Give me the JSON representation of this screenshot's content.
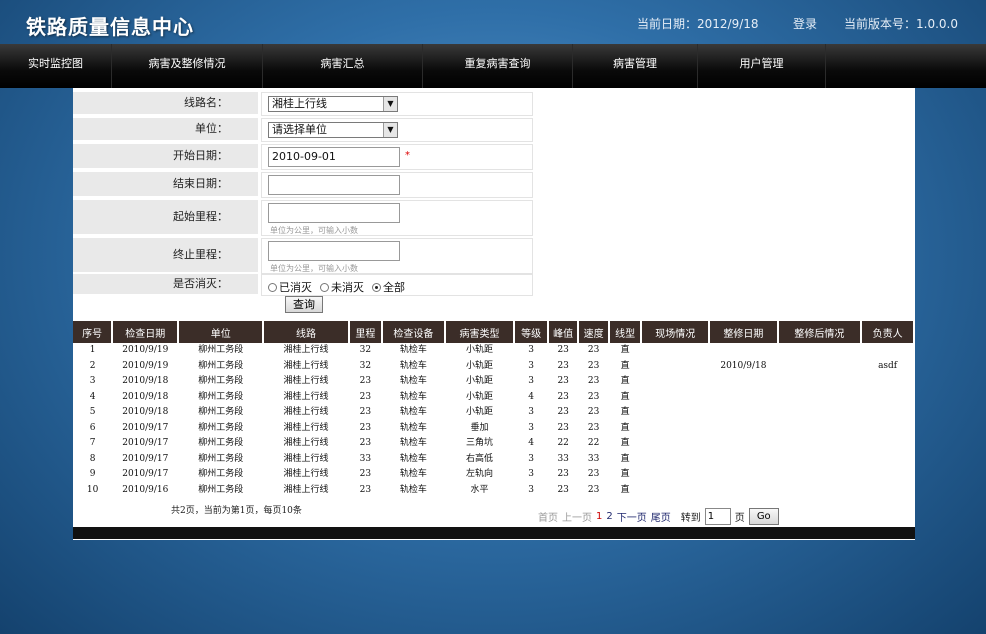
{
  "header": {
    "title": "铁路质量信息中心",
    "date_text": "当前日期：2012/9/18",
    "login": "登录",
    "version_text": "当前版本号：1.0.0.0"
  },
  "nav": {
    "items": [
      "实时监控图",
      "病害及整修情况",
      "病害汇总",
      "重复病害查询",
      "病害管理",
      "用户管理"
    ]
  },
  "form": {
    "line_label": "线路名：",
    "line_value": "湘桂上行线",
    "unit_label": "单位：",
    "unit_value": "请选择单位",
    "start_date_label": "开始日期：",
    "start_date_value": "2010-09-01",
    "required_mark": "*",
    "end_date_label": "结束日期：",
    "end_date_value": "",
    "start_km_label": "起始里程：",
    "start_km_value": "",
    "start_km_hint": "单位为公里，可输入小数",
    "end_km_label": "终止里程：",
    "end_km_value": "",
    "end_km_hint": "单位为公里，可输入小数",
    "eliminated_label": "是否消灭：",
    "radio_options": [
      "已消灭",
      "未消灭",
      "全部"
    ],
    "radio_selected": "全部",
    "query_button": "查询"
  },
  "table": {
    "headers": [
      "序号",
      "检查日期",
      "单位",
      "线路",
      "里程",
      "检查设备",
      "病害类型",
      "等级",
      "峰值",
      "速度",
      "线型",
      "现场情况",
      "整修日期",
      "整修后情况",
      "负责人"
    ],
    "rows": [
      [
        "1",
        "2010/9/19",
        "柳州工务段",
        "湘桂上行线",
        "32",
        "轨检车",
        "小轨距",
        "3",
        "23",
        "23",
        "直",
        "",
        "",
        "",
        ""
      ],
      [
        "2",
        "2010/9/19",
        "柳州工务段",
        "湘桂上行线",
        "32",
        "轨检车",
        "小轨距",
        "3",
        "23",
        "23",
        "直",
        "",
        "2010/9/18",
        "",
        "asdf"
      ],
      [
        "3",
        "2010/9/18",
        "柳州工务段",
        "湘桂上行线",
        "23",
        "轨检车",
        "小轨距",
        "3",
        "23",
        "23",
        "直",
        "",
        "",
        "",
        ""
      ],
      [
        "4",
        "2010/9/18",
        "柳州工务段",
        "湘桂上行线",
        "23",
        "轨检车",
        "小轨距",
        "4",
        "23",
        "23",
        "直",
        "",
        "",
        "",
        ""
      ],
      [
        "5",
        "2010/9/18",
        "柳州工务段",
        "湘桂上行线",
        "23",
        "轨检车",
        "小轨距",
        "3",
        "23",
        "23",
        "直",
        "",
        "",
        "",
        ""
      ],
      [
        "6",
        "2010/9/17",
        "柳州工务段",
        "湘桂上行线",
        "23",
        "轨检车",
        "垂加",
        "3",
        "23",
        "23",
        "直",
        "",
        "",
        "",
        ""
      ],
      [
        "7",
        "2010/9/17",
        "柳州工务段",
        "湘桂上行线",
        "23",
        "轨检车",
        "三角坑",
        "4",
        "22",
        "22",
        "直",
        "",
        "",
        "",
        ""
      ],
      [
        "8",
        "2010/9/17",
        "柳州工务段",
        "湘桂上行线",
        "33",
        "轨检车",
        "右高低",
        "3",
        "33",
        "33",
        "直",
        "",
        "",
        "",
        ""
      ],
      [
        "9",
        "2010/9/17",
        "柳州工务段",
        "湘桂上行线",
        "23",
        "轨检车",
        "左轨向",
        "3",
        "23",
        "23",
        "直",
        "",
        "",
        "",
        ""
      ],
      [
        "10",
        "2010/9/16",
        "柳州工务段",
        "湘桂上行线",
        "23",
        "轨检车",
        "水平",
        "3",
        "23",
        "23",
        "直",
        "",
        "",
        "",
        ""
      ]
    ]
  },
  "pager": {
    "summary": "共2页，当前为第1页，每页10条",
    "first": "首页",
    "prev": "上一页",
    "page1": "1",
    "page2": "2",
    "next": "下一页",
    "last": "尾页",
    "goto_label": "转到",
    "goto_value": "1",
    "page_suffix": "页",
    "go_button": "Go"
  }
}
